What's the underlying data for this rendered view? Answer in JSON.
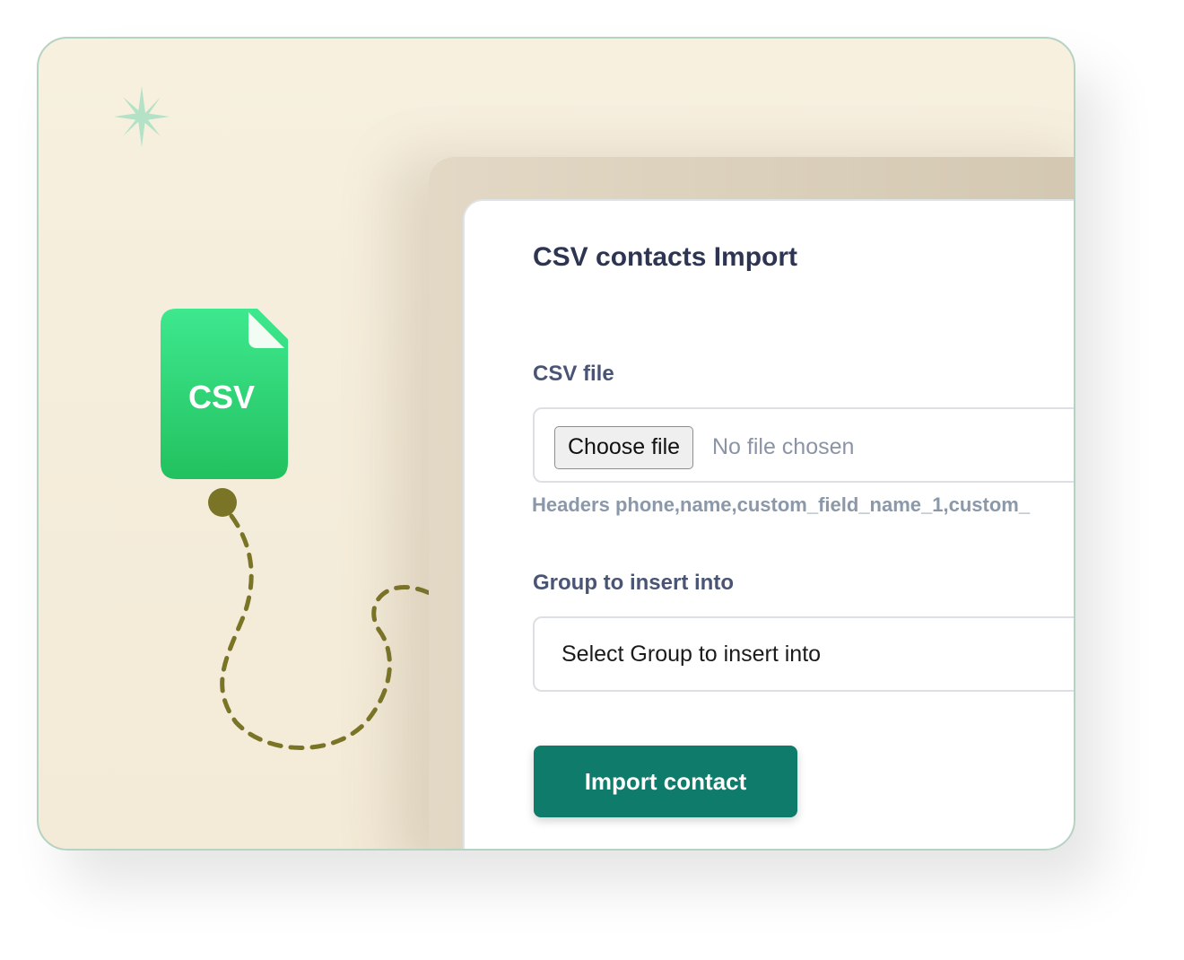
{
  "modal": {
    "title": "CSV contacts Import",
    "csv_file_label": "CSV file",
    "choose_file_label": "Choose file",
    "no_file_text": "No file chosen",
    "headers_hint": "Headers phone,name,custom_field_name_1,custom_",
    "group_label": "Group to insert into",
    "group_select_value": "Select Group to insert into",
    "import_button_label": "Import contact"
  },
  "csv_icon": {
    "label": "CSV",
    "color": "#2ecc71"
  },
  "colors": {
    "accent": "#0e7b6b",
    "card_bg": "#f6eedd",
    "card_border": "#b6d2c2",
    "path_color": "#7a7526",
    "sparkle": "#b3e2c6"
  },
  "icons": [
    "sparkle-icon",
    "csv-file-icon",
    "dashed-path-icon"
  ]
}
